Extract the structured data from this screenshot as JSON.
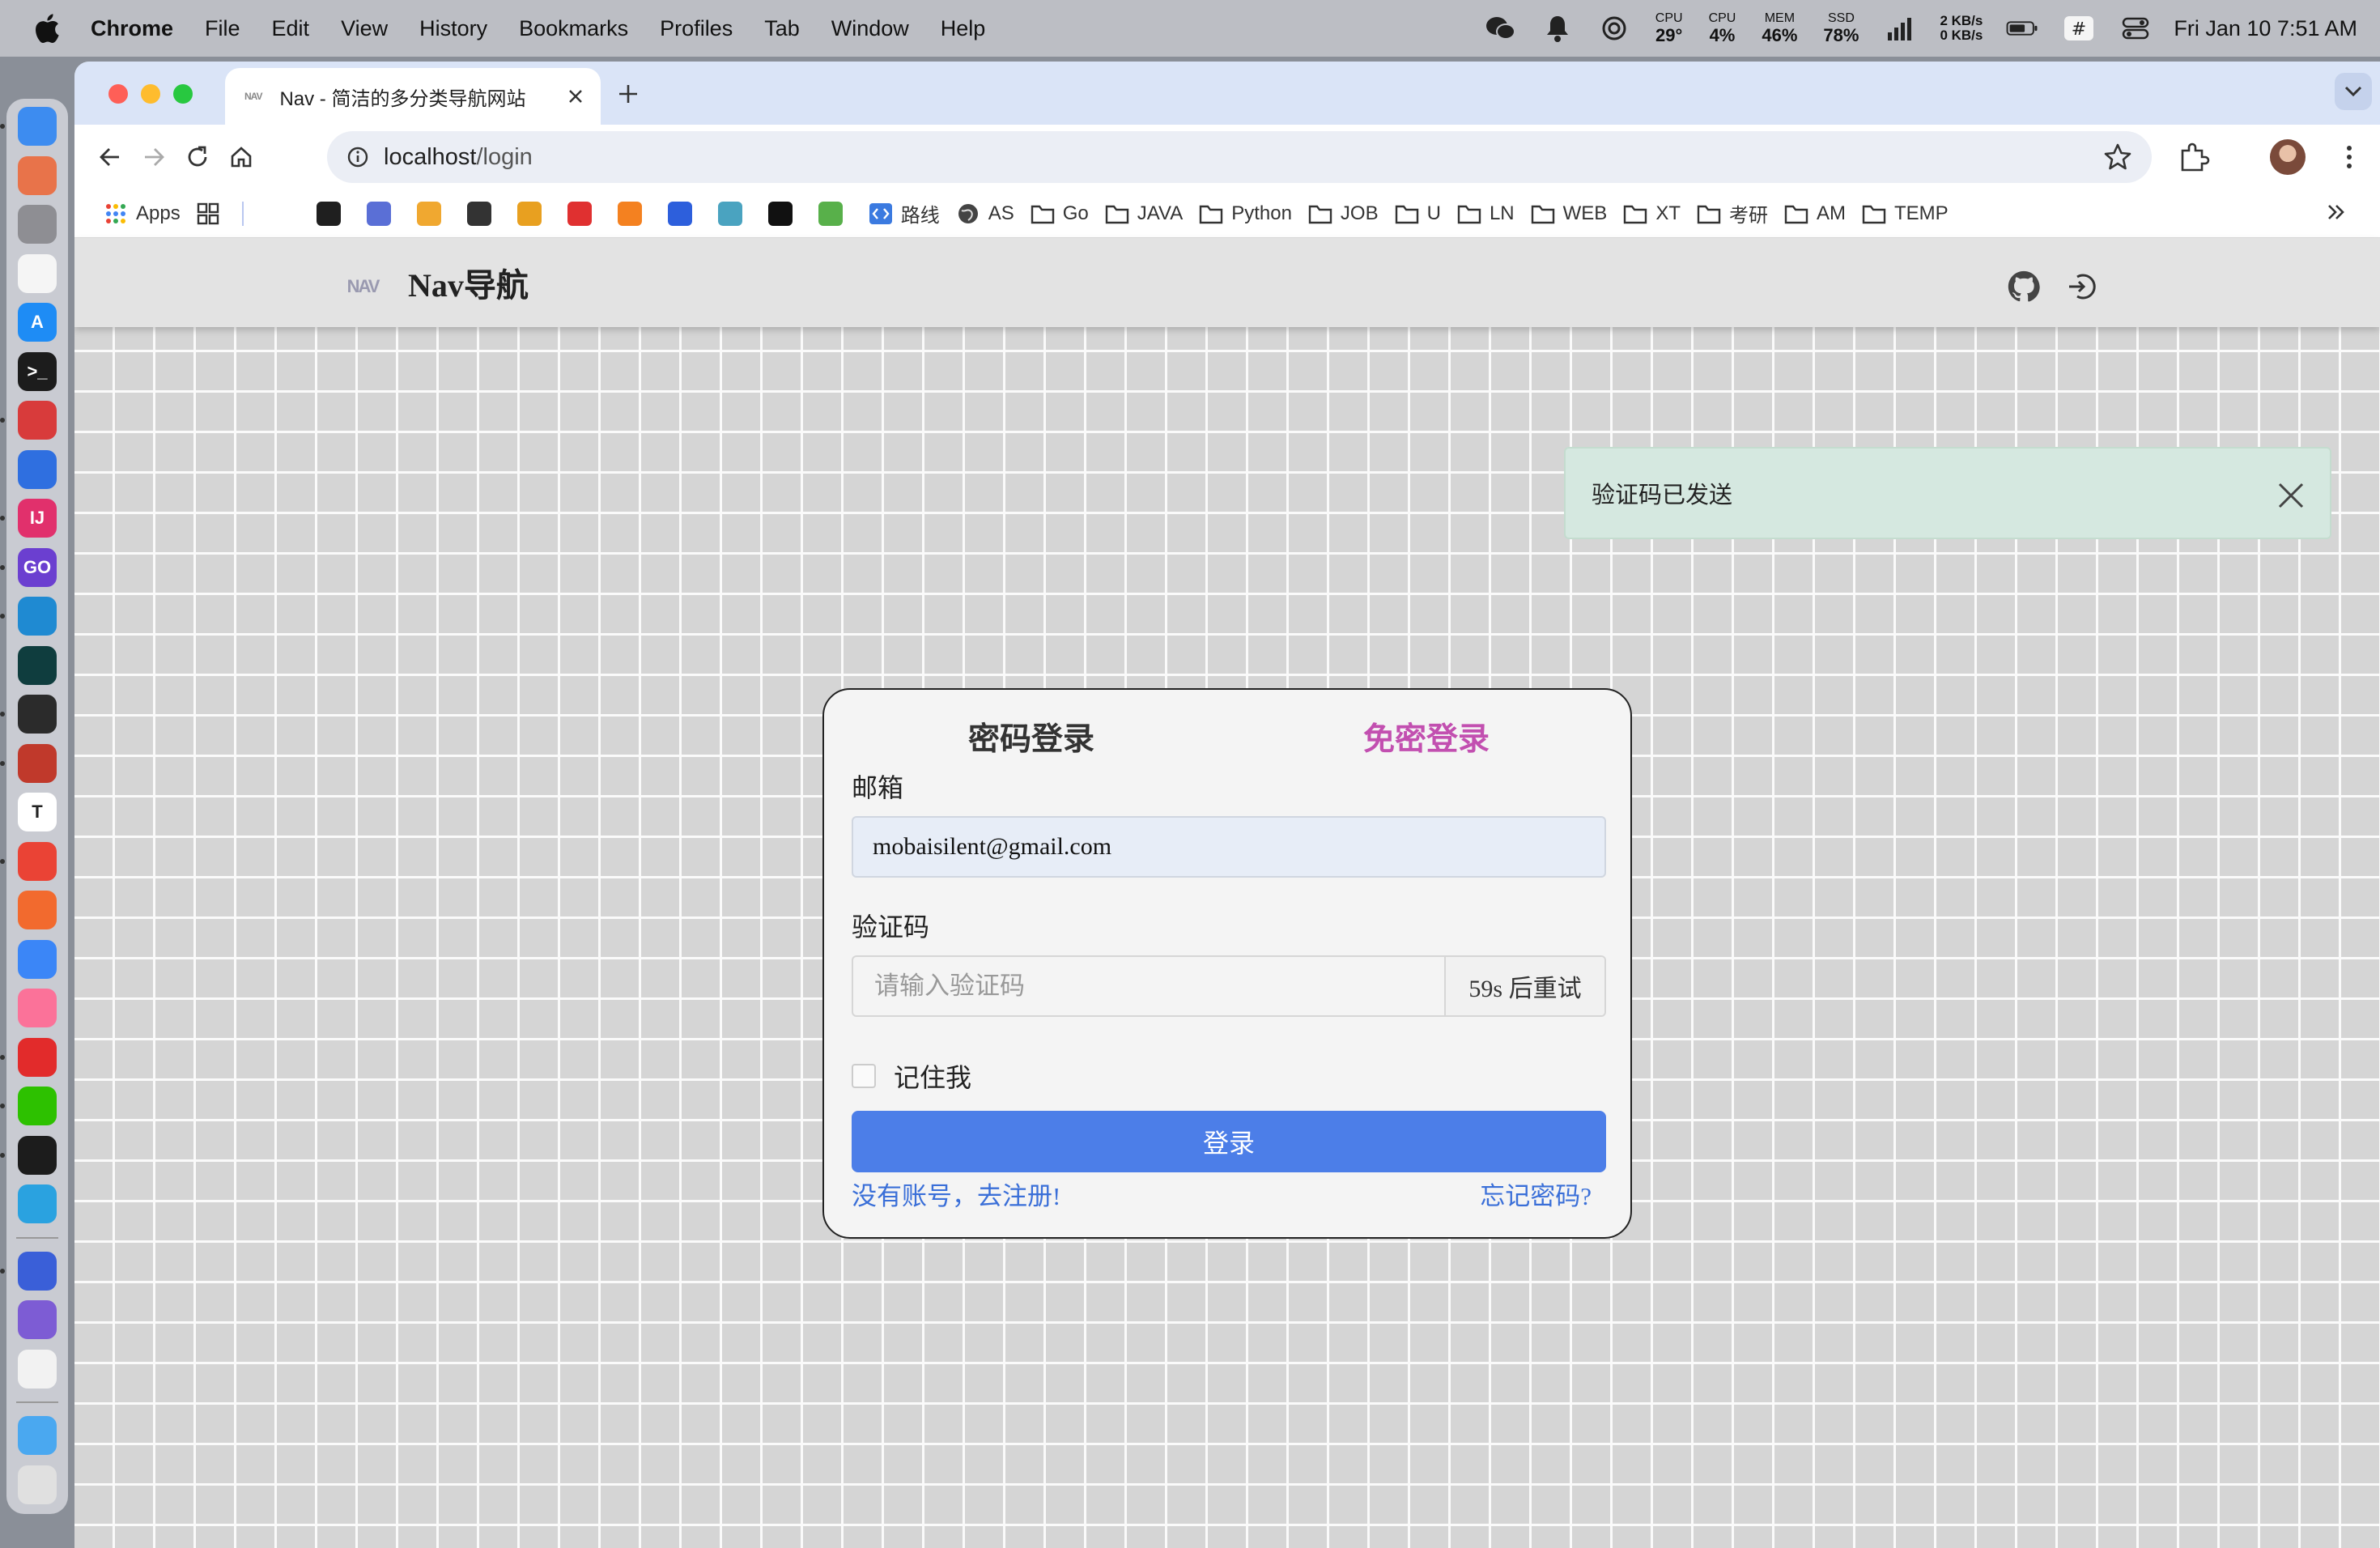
{
  "menubar": {
    "app": "Chrome",
    "items": [
      "File",
      "Edit",
      "View",
      "History",
      "Bookmarks",
      "Profiles",
      "Tab",
      "Window",
      "Help"
    ],
    "stats": [
      {
        "label": "CPU",
        "value": "29°"
      },
      {
        "label": "CPU",
        "value": "4%"
      },
      {
        "label": "MEM",
        "value": "46%"
      },
      {
        "label": "SSD",
        "value": "78%"
      }
    ],
    "net_up": "2 KB/s",
    "net_down": "0 KB/s",
    "clock": "Fri Jan 10  7:51 AM"
  },
  "browser": {
    "tab": {
      "favicon_text": "NAV",
      "title": "Nav - 简洁的多分类导航网站"
    },
    "url_host": "localhost",
    "url_path": "/login",
    "bookmarks_apps": "Apps",
    "bookmark_favicons": [
      "#1f1f1f",
      "#5a6fd6",
      "#f0a830",
      "#333333",
      "#e8a020",
      "#e03030",
      "#f48120",
      "#2d5fdc",
      "#4aa3c0",
      "#111111",
      "#58b04a"
    ],
    "bookmarks": [
      {
        "label": "路线",
        "icon": "code-square-icon",
        "color": "#3b7ae0"
      },
      {
        "label": "AS",
        "icon": "globe-icon",
        "color": "#333"
      },
      {
        "label": "Go",
        "icon": "folder-icon",
        "color": "#333"
      },
      {
        "label": "JAVA",
        "icon": "folder-icon",
        "color": "#333"
      },
      {
        "label": "Python",
        "icon": "folder-icon",
        "color": "#333"
      },
      {
        "label": "JOB",
        "icon": "folder-icon",
        "color": "#333"
      },
      {
        "label": "U",
        "icon": "folder-icon",
        "color": "#333"
      },
      {
        "label": "LN",
        "icon": "folder-icon",
        "color": "#333"
      },
      {
        "label": "WEB",
        "icon": "folder-icon",
        "color": "#333"
      },
      {
        "label": "XT",
        "icon": "folder-icon",
        "color": "#333"
      },
      {
        "label": "考研",
        "icon": "folder-icon",
        "color": "#333"
      },
      {
        "label": "AM",
        "icon": "folder-icon",
        "color": "#333"
      },
      {
        "label": "TEMP",
        "icon": "folder-icon",
        "color": "#333"
      }
    ]
  },
  "dock": {
    "apps": [
      {
        "name": "finder",
        "color": "#3d8cf0",
        "glyph": "",
        "running": true
      },
      {
        "name": "launchpad",
        "color": "#e8734a",
        "glyph": "",
        "running": false
      },
      {
        "name": "system-settings",
        "color": "#8e8e93",
        "glyph": "",
        "running": false
      },
      {
        "name": "reminders",
        "color": "#f5f5f5",
        "glyph": "",
        "running": false
      },
      {
        "name": "app-store",
        "color": "#1e8cf5",
        "glyph": "A",
        "running": false
      },
      {
        "name": "terminal",
        "color": "#1c1c1c",
        "glyph": ">_",
        "running": false
      },
      {
        "name": "remote-desktop",
        "color": "#d83b3b",
        "glyph": "",
        "running": true
      },
      {
        "name": "sound-analyzer",
        "color": "#2f6fe0",
        "glyph": "",
        "running": false
      },
      {
        "name": "intellij-idea",
        "color": "#e1306c",
        "glyph": "IJ",
        "running": true
      },
      {
        "name": "goland",
        "color": "#6b3fd0",
        "glyph": "GO",
        "running": true
      },
      {
        "name": "vscode",
        "color": "#1f8ad2",
        "glyph": "",
        "running": true
      },
      {
        "name": "qoder",
        "color": "#0f3d3e",
        "glyph": "",
        "running": false
      },
      {
        "name": "davinci",
        "color": "#2b2b2b",
        "glyph": "",
        "running": true
      },
      {
        "name": "creative-app",
        "color": "#c0392b",
        "glyph": "",
        "running": true
      },
      {
        "name": "typora",
        "color": "#ffffff",
        "glyph": "T",
        "running": false
      },
      {
        "name": "chrome",
        "color": "#ea4335",
        "glyph": "",
        "running": true
      },
      {
        "name": "git-tower",
        "color": "#f26a2e",
        "glyph": "",
        "running": false
      },
      {
        "name": "baidu-cloud",
        "color": "#3b86f7",
        "glyph": "",
        "running": false
      },
      {
        "name": "bilibili",
        "color": "#fb7299",
        "glyph": "",
        "running": false
      },
      {
        "name": "netease-music",
        "color": "#e22b2b",
        "glyph": "",
        "running": true
      },
      {
        "name": "wechat",
        "color": "#2dc100",
        "glyph": "",
        "running": true
      },
      {
        "name": "qq",
        "color": "#1c1c1c",
        "glyph": "",
        "running": true
      },
      {
        "name": "telegram",
        "color": "#2aa2e0",
        "glyph": "",
        "running": false
      },
      {
        "name": "infuse",
        "color": "#3a5fd8",
        "glyph": "",
        "running": true
      },
      {
        "name": "simulator",
        "color": "#7d5cd4",
        "glyph": "",
        "running": false
      },
      {
        "name": "chatgpt",
        "color": "#f2f2f2",
        "glyph": "",
        "running": false
      },
      {
        "name": "downloads-folder",
        "color": "#4aa8f0",
        "glyph": "",
        "running": false
      },
      {
        "name": "trash",
        "color": "#e0e0e0",
        "glyph": "",
        "running": false
      }
    ]
  },
  "site": {
    "logo_text": "NAV",
    "brand": "Nav导航"
  },
  "toast": {
    "message": "验证码已发送",
    "bg_color": "#d5e8e0"
  },
  "login": {
    "tabs": [
      {
        "label": "密码登录",
        "active": false
      },
      {
        "label": "免密登录",
        "active": true,
        "color": "#c24fb0"
      }
    ],
    "email_label": "邮箱",
    "email_value": "mobaisilent@gmail.com",
    "code_label": "验证码",
    "code_placeholder": "请输入验证码",
    "resend_label": "59s 后重试",
    "remember_label": "记住我",
    "remember_checked": false,
    "submit_label": "登录",
    "submit_color": "#4c7ee8",
    "register_link": "没有账号，去注册!",
    "forgot_link": "忘记密码?"
  }
}
